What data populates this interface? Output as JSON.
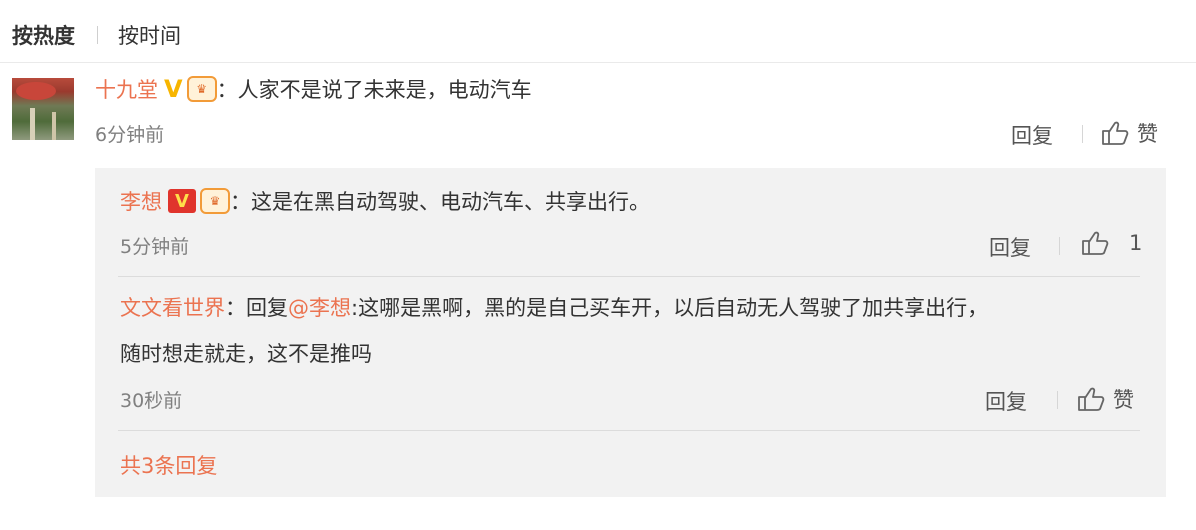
{
  "sort_tabs": [
    {
      "label": "按热度",
      "active": true
    },
    {
      "label": "按时间",
      "active": false
    }
  ],
  "comment": {
    "user": "十九堂",
    "badge_verify": "V",
    "colon": "：",
    "text": "人家不是说了未来是，电动汽车",
    "time": "6分钟前",
    "reply_label": "回复",
    "like_label": "赞"
  },
  "replies": [
    {
      "user": "李想",
      "badge_verify": "V",
      "colon": "：",
      "text": "这是在黑自动驾驶、电动汽车、共享出行。",
      "time": "5分钟前",
      "reply_label": "回复",
      "like_label": "1"
    },
    {
      "user": "文文看世界",
      "colon": "：",
      "prefix": "回复",
      "mention": "@李想",
      "text_line1": ":这哪是黑啊，黑的是自己买车开，以后自动无人驾驶了加共享出行，",
      "text_line2": "随时想走就走，这不是推吗",
      "time": "30秒前",
      "reply_label": "回复",
      "like_label": "赞"
    }
  ],
  "more_replies": "共3条回复",
  "colors": {
    "accent": "#eb7350",
    "verify_gold": "#f7b500",
    "verify_red": "#e0342c",
    "reply_bg": "#f2f2f2"
  },
  "icons": [
    "thumbs-up-icon",
    "member-badge-icon",
    "verified-icon"
  ]
}
